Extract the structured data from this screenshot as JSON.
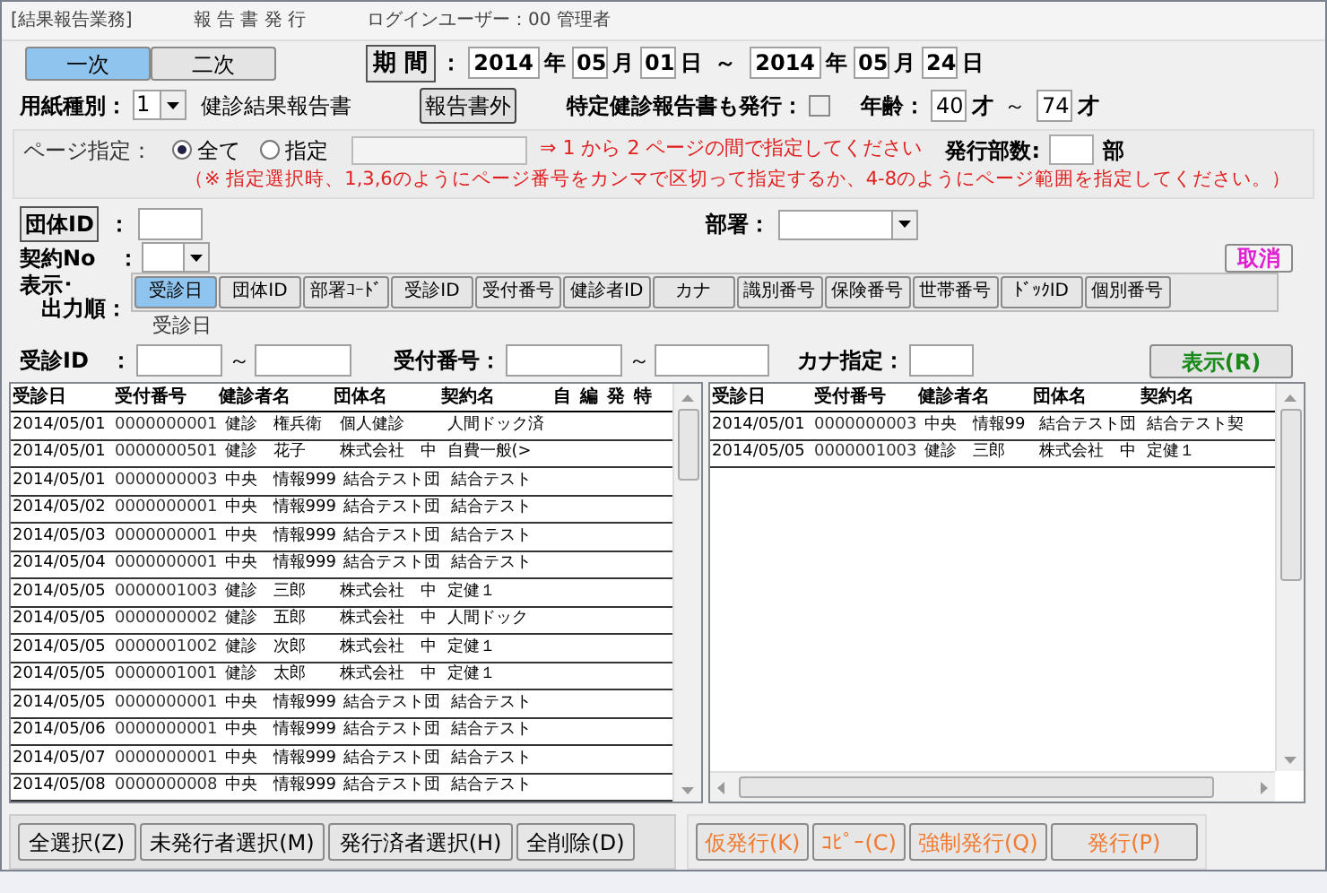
{
  "header": {
    "module": "[結果報告業務]",
    "title": "報 告 書 発 行",
    "user": "ログインユーザー：00 管理者"
  },
  "phase_tabs": [
    {
      "label": "一次",
      "selected": true
    },
    {
      "label": "二次",
      "selected": false
    }
  ],
  "period": {
    "label": "期 間",
    "colon": "：",
    "from_year": "2014",
    "from_year_unit": "年",
    "from_month": "05",
    "from_month_unit": "月",
    "from_day": "01",
    "from_day_unit": "日",
    "sep": "～",
    "to_year": "2014",
    "to_year_unit": "年",
    "to_month": "05",
    "to_month_unit": "月",
    "to_day": "24",
    "to_day_unit": "日"
  },
  "paper": {
    "label": "用紙種別：",
    "value": "1",
    "name": "健診結果報告書",
    "extra_button": "報告書外"
  },
  "specific": {
    "label": "特定健診報告書も発行：",
    "checked": false
  },
  "age": {
    "label": "年齢：",
    "from": "40",
    "from_unit": "才",
    "sep": "～",
    "to": "74",
    "to_unit": "才"
  },
  "page_spec": {
    "label": "ページ指定：",
    "options": [
      {
        "label": "全て",
        "selected": true
      },
      {
        "label": "指定",
        "selected": false
      }
    ],
    "hint": "⇒ 1 から 2 ページの間で指定してください",
    "copies_label": "発行部数:",
    "copies_unit": "部",
    "note": "（※ 指定選択時、1,3,6のようにページ番号をカンマで区切って指定するか、4-8のようにページ範囲を指定してください。）"
  },
  "group_id": {
    "label": "団体ID",
    "colon": "："
  },
  "department": {
    "label": "部署："
  },
  "contract_no": {
    "label": "契約No　："
  },
  "cancel_button": "取消",
  "sort": {
    "label_1": "表示･",
    "label_2": "出力順：",
    "buttons": [
      {
        "label": "受診日",
        "selected": true
      },
      {
        "label": "団体ID",
        "selected": false
      },
      {
        "label": "部署ｺｰﾄﾞ",
        "selected": false
      },
      {
        "label": "受診ID",
        "selected": false
      },
      {
        "label": "受付番号",
        "selected": false
      },
      {
        "label": "健診者ID",
        "selected": false
      },
      {
        "label": "カナ",
        "selected": false
      },
      {
        "label": "識別番号",
        "selected": false
      },
      {
        "label": "保険番号",
        "selected": false
      },
      {
        "label": "世帯番号",
        "selected": false
      },
      {
        "label": "ﾄﾞｯｸID",
        "selected": false
      },
      {
        "label": "個別番号",
        "selected": false
      }
    ],
    "current": "受診日"
  },
  "filters": {
    "exam_id_label": "受診ID　：",
    "sep": "～",
    "receipt_label": "受付番号：",
    "sep2": "～",
    "kana_label": "カナ指定：",
    "show_button": "表示(R)"
  },
  "left_table": {
    "columns": [
      "受診日",
      "受付番号",
      "健診者名",
      "団体名",
      "契約名"
    ],
    "flags": [
      "自",
      "編",
      "発",
      "特"
    ],
    "rows": [
      [
        "2014/05/01",
        "0000000001",
        "健診　権兵衛",
        "個人健診",
        "人間ドック済"
      ],
      [
        "2014/05/01",
        "0000000501",
        "健診　花子",
        "株式会社　中",
        "自費一般(>"
      ],
      [
        "2014/05/01",
        "0000000003",
        "中央　情報999",
        "結合テスト団",
        "結合テスト"
      ],
      [
        "2014/05/02",
        "0000000001",
        "中央　情報999",
        "結合テスト団",
        "結合テスト"
      ],
      [
        "2014/05/03",
        "0000000001",
        "中央　情報999",
        "結合テスト団",
        "結合テスト"
      ],
      [
        "2014/05/04",
        "0000000001",
        "中央　情報999",
        "結合テスト団",
        "結合テスト"
      ],
      [
        "2014/05/05",
        "0000001003",
        "健診　三郎",
        "株式会社　中",
        "定健１"
      ],
      [
        "2014/05/05",
        "0000000002",
        "健診　五郎",
        "株式会社　中",
        "人間ドック"
      ],
      [
        "2014/05/05",
        "0000001002",
        "健診　次郎",
        "株式会社　中",
        "定健１"
      ],
      [
        "2014/05/05",
        "0000001001",
        "健診　太郎",
        "株式会社　中",
        "定健１"
      ],
      [
        "2014/05/05",
        "0000000001",
        "中央　情報999",
        "結合テスト団",
        "結合テスト"
      ],
      [
        "2014/05/06",
        "0000000001",
        "中央　情報999",
        "結合テスト団",
        "結合テスト"
      ],
      [
        "2014/05/07",
        "0000000001",
        "中央　情報999",
        "結合テスト団",
        "結合テスト"
      ],
      [
        "2014/05/08",
        "0000000008",
        "中央　情報999",
        "結合テスト団",
        "結合テスト"
      ]
    ]
  },
  "right_table": {
    "columns": [
      "受診日",
      "受付番号",
      "健診者名",
      "団体名",
      "契約名"
    ],
    "rows": [
      [
        "2014/05/01",
        "0000000003",
        "中央　情報99",
        "結合テスト団",
        "結合テスト契"
      ],
      [
        "2014/05/05",
        "0000001003",
        "健診　三郎",
        "株式会社　中",
        "定健１"
      ]
    ]
  },
  "select_buttons": [
    "全選択(Z)",
    "未発行者選択(M)",
    "発行済者選択(H)",
    "全削除(D)"
  ],
  "issue_buttons": [
    "仮発行(K)",
    "ｺﾋﾟｰ(C)",
    "強制発行(Q)",
    "発行(P)"
  ]
}
